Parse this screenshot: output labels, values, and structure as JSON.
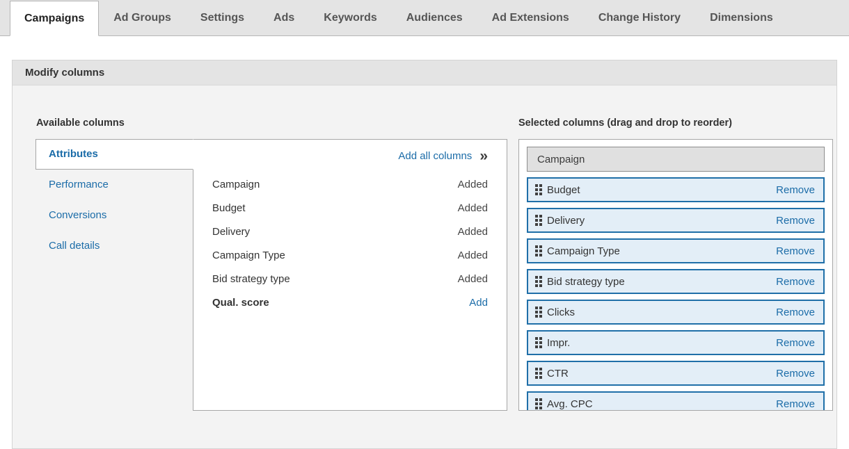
{
  "tabs": [
    {
      "label": "Campaigns",
      "active": true
    },
    {
      "label": "Ad Groups",
      "active": false
    },
    {
      "label": "Settings",
      "active": false
    },
    {
      "label": "Ads",
      "active": false
    },
    {
      "label": "Keywords",
      "active": false
    },
    {
      "label": "Audiences",
      "active": false
    },
    {
      "label": "Ad Extensions",
      "active": false
    },
    {
      "label": "Change History",
      "active": false
    },
    {
      "label": "Dimensions",
      "active": false
    }
  ],
  "panel": {
    "title": "Modify columns"
  },
  "available": {
    "title": "Available columns",
    "categories": [
      {
        "label": "Attributes",
        "active": true
      },
      {
        "label": "Performance",
        "active": false
      },
      {
        "label": "Conversions",
        "active": false
      },
      {
        "label": "Call details",
        "active": false
      }
    ],
    "add_all_label": "Add all columns",
    "add_all_icon": "double-chevron-right-icon",
    "rows": [
      {
        "name": "Campaign",
        "status": "Added",
        "is_add": false,
        "bold": false
      },
      {
        "name": "Budget",
        "status": "Added",
        "is_add": false,
        "bold": false
      },
      {
        "name": "Delivery",
        "status": "Added",
        "is_add": false,
        "bold": false
      },
      {
        "name": "Campaign Type",
        "status": "Added",
        "is_add": false,
        "bold": false
      },
      {
        "name": "Bid strategy type",
        "status": "Added",
        "is_add": false,
        "bold": false
      },
      {
        "name": "Qual. score",
        "status": "Add",
        "is_add": true,
        "bold": true
      }
    ]
  },
  "selected": {
    "title": "Selected columns (drag and drop to reorder)",
    "remove_label": "Remove",
    "drag_handle_icon": "drag-handle-icon",
    "rows": [
      {
        "name": "Campaign",
        "locked": true
      },
      {
        "name": "Budget",
        "locked": false
      },
      {
        "name": "Delivery",
        "locked": false
      },
      {
        "name": "Campaign Type",
        "locked": false
      },
      {
        "name": "Bid strategy type",
        "locked": false
      },
      {
        "name": "Clicks",
        "locked": false
      },
      {
        "name": "Impr.",
        "locked": false
      },
      {
        "name": "CTR",
        "locked": false
      },
      {
        "name": "Avg. CPC",
        "locked": false
      }
    ]
  },
  "colors": {
    "link": "#1b6ca8",
    "row_border": "#1f6fa8",
    "row_fill": "#e3eef7",
    "locked_fill": "#e0e0e0",
    "tabbar_bg": "#e4e4e4",
    "panel_bg": "#f3f3f3"
  }
}
